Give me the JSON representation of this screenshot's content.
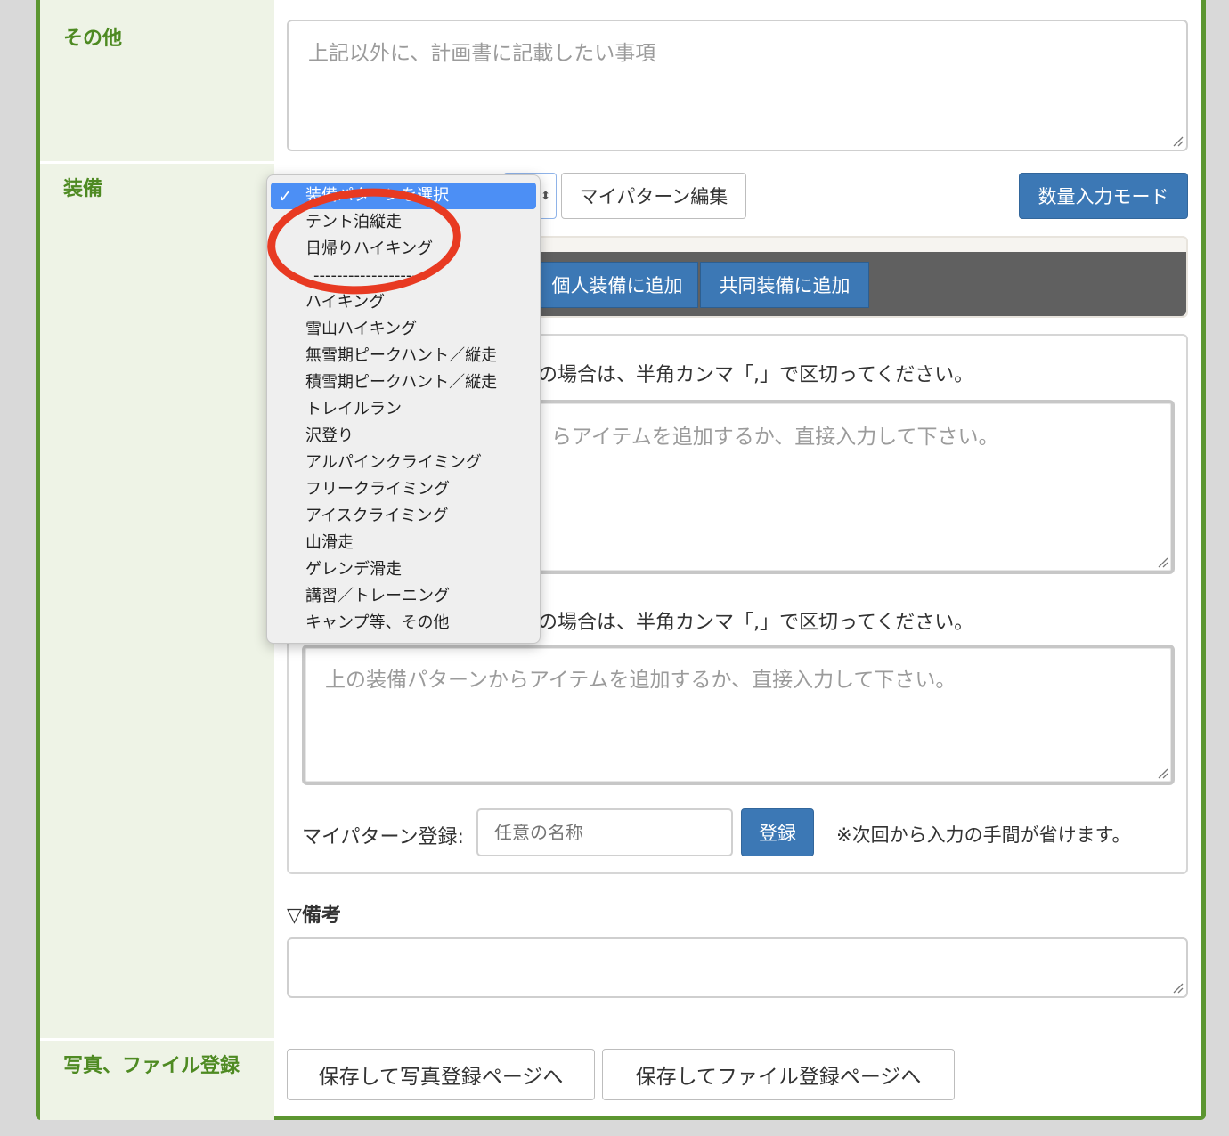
{
  "sections": {
    "other": {
      "label": "その他",
      "placeholder": "上記以外に、計画書に記載したい事項"
    },
    "equipment": {
      "label": "装備",
      "pattern_select": {
        "selected": "装備パターンを選択",
        "options": [
          "装備パターンを選択",
          "テント泊縦走",
          "日帰りハイキング",
          "--------------------",
          "ハイキング",
          "雪山ハイキング",
          "無雪期ピークハント／縦走",
          "積雪期ピークハント／縦走",
          "トレイルラン",
          "沢登り",
          "アルパインクライミング",
          "フリークライミング",
          "アイスクライミング",
          "山滑走",
          "ゲレンデ滑走",
          "講習／トレーニング",
          "キャンプ等、その他"
        ]
      },
      "my_pattern_edit": "マイパターン編集",
      "quantity_mode": "数量入力モード",
      "add_personal": "個人装備に追加",
      "add_shared": "共同装備に追加",
      "hint_text": "の場合は、半角カンマ「,」で区切ってください。",
      "hint_text2": "の場合は、半角カンマ「,」で区切ってください。",
      "textarea1_placeholder": "上の装備パターンからアイテムを追加するか、直接入力して下さい。",
      "textarea1_visible": "らアイテムを追加するか、直接入力して下さい。",
      "textarea2_placeholder": "上の装備パターンからアイテムを追加するか、直接入力して下さい。",
      "my_pattern_register_label": "マイパターン登録:",
      "name_placeholder": "任意の名称",
      "register_button": "登録",
      "register_note": "※次回から入力の手間が省けます。",
      "remarks_label": "▽備考"
    },
    "files": {
      "label": "写真、ファイル登録",
      "photo_button": "保存して写真登録ページへ",
      "file_button": "保存してファイル登録ページへ"
    }
  },
  "colors": {
    "label_green": "#4e8a22",
    "frame_green": "#5c9631",
    "button_blue": "#3c78b5",
    "highlight": "#4c8ff5",
    "annotation_red": "#e83a22"
  }
}
